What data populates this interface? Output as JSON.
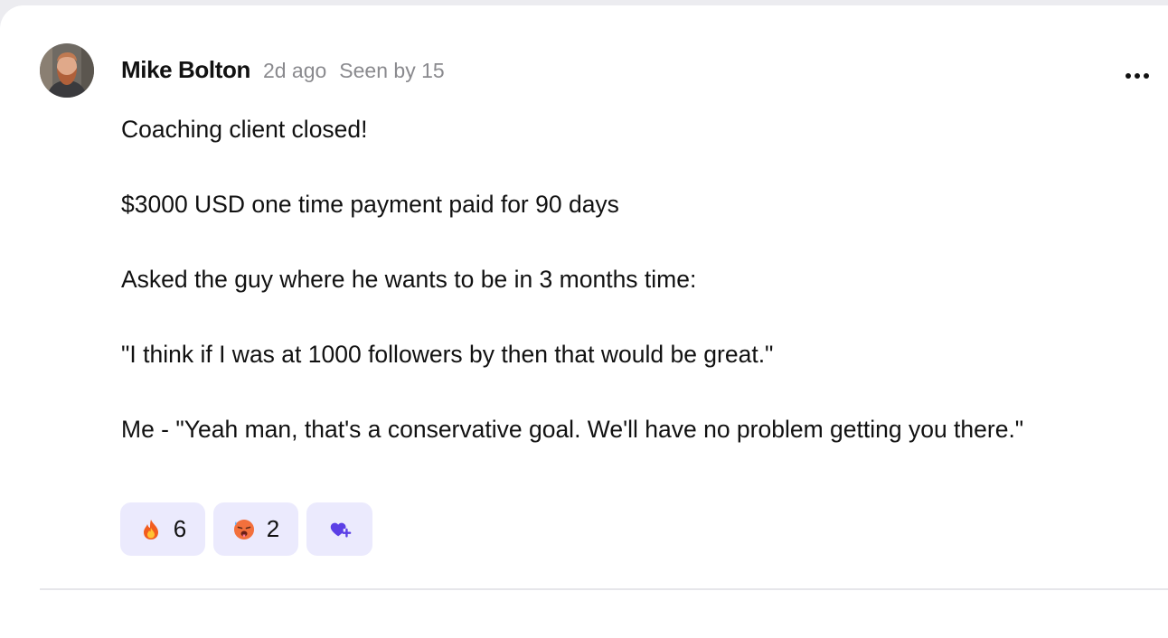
{
  "post": {
    "author": "Mike Bolton",
    "time": "2d ago",
    "seen": "Seen by 15",
    "avatar_icon": "user-avatar-photo",
    "more_icon": "more-horizontal-icon",
    "paragraphs": [
      "Coaching client closed!",
      "$3000 USD one time payment paid for 90 days",
      "Asked the guy where he wants to be in 3 months time:",
      "\"I think if I was at 1000 followers by then that would be great.\"",
      "Me - \"Yeah man, that's a conservative goal. We'll have no problem getting you there.\""
    ]
  },
  "reactions": [
    {
      "icon": "fire-emoji-icon",
      "count": "6"
    },
    {
      "icon": "hot-face-emoji-icon",
      "count": "2"
    }
  ],
  "add_reaction_icon": "add-reaction-heart-icon",
  "colors": {
    "reaction_bg": "#ebeafd",
    "accent": "#5b3fe6",
    "meta_text": "#8a8a8e"
  }
}
